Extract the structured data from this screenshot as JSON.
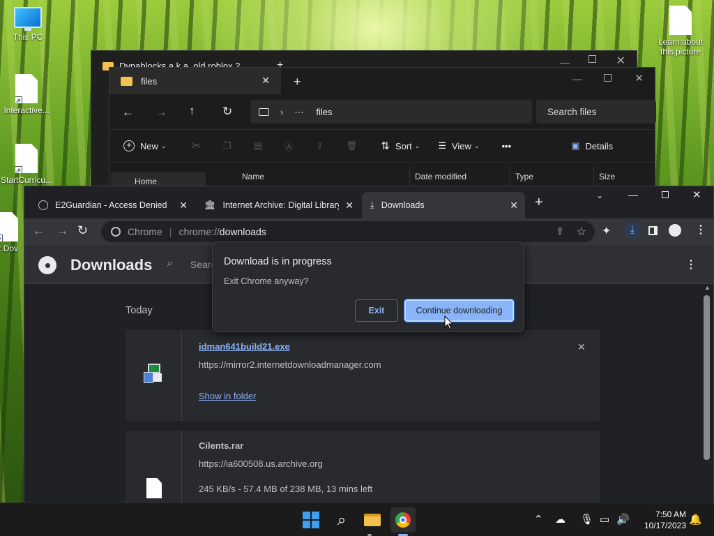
{
  "desktop": {
    "icons": [
      {
        "label": "This PC"
      },
      {
        "label": "Interactive..."
      },
      {
        "label": "StartCurricu..."
      },
      {
        "label": "Int Dov"
      },
      {
        "label": "Learn about this picture"
      }
    ]
  },
  "explorer_back": {
    "tab_title": "Dynablocks a.k.a. old roblox 2..."
  },
  "explorer": {
    "tab_title": "files",
    "breadcrumb_current": "files",
    "search_placeholder": "Search files",
    "commands": {
      "new": "New",
      "sort": "Sort",
      "view": "View",
      "more": "•••",
      "details": "Details"
    },
    "sidebar_home": "Home",
    "columns": [
      "Name",
      "Date modified",
      "Type",
      "Size"
    ]
  },
  "chrome": {
    "tabs": [
      {
        "title": "E2Guardian - Access Denied"
      },
      {
        "title": "Internet Archive: Digital Library"
      },
      {
        "title": "Downloads"
      }
    ],
    "omnibox": {
      "site_label": "Chrome",
      "url_prefix": "chrome://",
      "url_path": "downloads"
    },
    "downloads_page": {
      "title": "Downloads",
      "search_placeholder": "Search",
      "section_today": "Today",
      "items": [
        {
          "filename": "idman641build21.exe",
          "source": "https://mirror2.internetdownloadmanager.com",
          "action": "Show in folder",
          "remove": "✕"
        },
        {
          "filename": "Cilents.rar",
          "source": "https://ia600508.us.archive.org",
          "status": "245 KB/s - 57.4 MB of 238 MB, 13 mins left"
        }
      ]
    },
    "dialog": {
      "title": "Download is in progress",
      "message": "Exit Chrome anyway?",
      "exit_label": "Exit",
      "continue_label": "Continue downloading"
    }
  },
  "taskbar": {
    "time": "7:50 AM",
    "date": "10/17/2023"
  },
  "colors": {
    "accent": "#8ab4f8",
    "chrome_bg": "#202124",
    "dialog_bg": "#292a2d"
  }
}
